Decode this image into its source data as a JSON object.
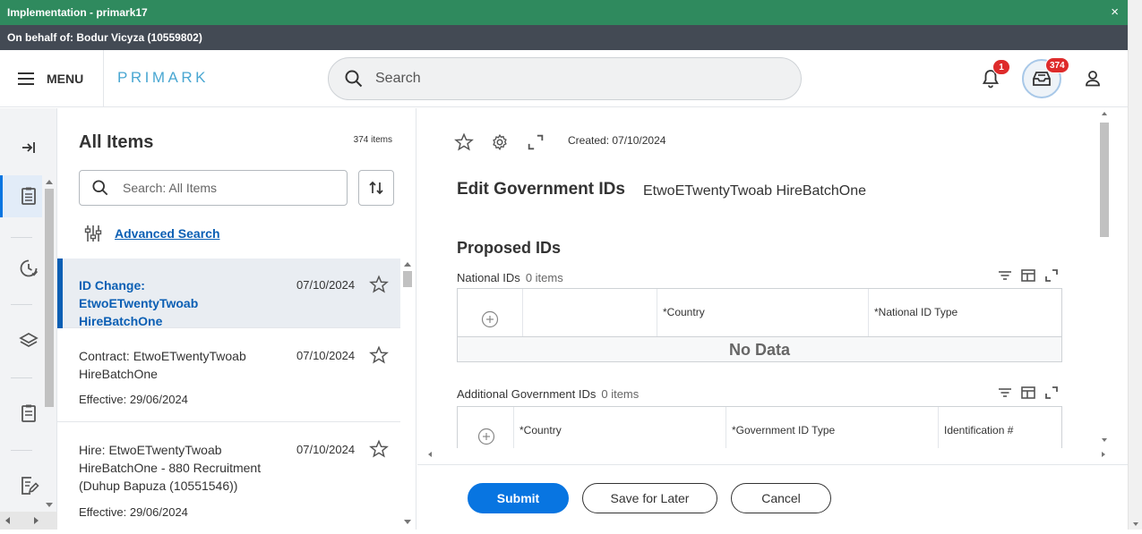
{
  "banner": {
    "title": "Implementation - primark17",
    "close": "×"
  },
  "proxy": {
    "text": "On behalf of: Bodur Vicyza (10559802)"
  },
  "header": {
    "menu_label": "MENU",
    "logo": "PRIMARK",
    "search_placeholder": "Search",
    "notifications_count": "1",
    "inbox_count": "374"
  },
  "items_panel": {
    "title": "All Items",
    "count": "374 items",
    "search_placeholder": "Search: All Items",
    "advanced_search": "Advanced Search",
    "items": [
      {
        "title": "ID Change: EtwoETwentyTwoab HireBatchOne",
        "date": "07/10/2024",
        "effective": ""
      },
      {
        "title": "Contract: EtwoETwentyTwoab HireBatchOne",
        "date": "07/10/2024",
        "effective": "Effective: 29/06/2024"
      },
      {
        "title": "Hire: EtwoETwentyTwoab HireBatchOne - 880 Recruitment (Duhup Bapuza (10551546))",
        "date": "07/10/2024",
        "effective": "Effective: 29/06/2024"
      }
    ]
  },
  "main": {
    "created": "Created: 07/10/2024",
    "title": "Edit Government IDs",
    "subject": "EtwoETwentyTwoab HireBatchOne",
    "section": "Proposed IDs",
    "national_ids": {
      "label": "National IDs",
      "count": "0 items",
      "columns": [
        "*Country",
        "*National ID Type"
      ],
      "empty": "No Data"
    },
    "additional_ids": {
      "label": "Additional Government IDs",
      "count": "0 items",
      "columns": [
        "*Country",
        "*Government ID Type",
        "Identification #"
      ]
    }
  },
  "footer": {
    "submit": "Submit",
    "save_later": "Save for Later",
    "cancel": "Cancel"
  },
  "colors": {
    "banner": "#2f8a5e",
    "proxy": "#434a54",
    "accent": "#0875e1",
    "link": "#0b5fb4",
    "badge": "#de2b2b",
    "logo": "#4aa7d2"
  }
}
